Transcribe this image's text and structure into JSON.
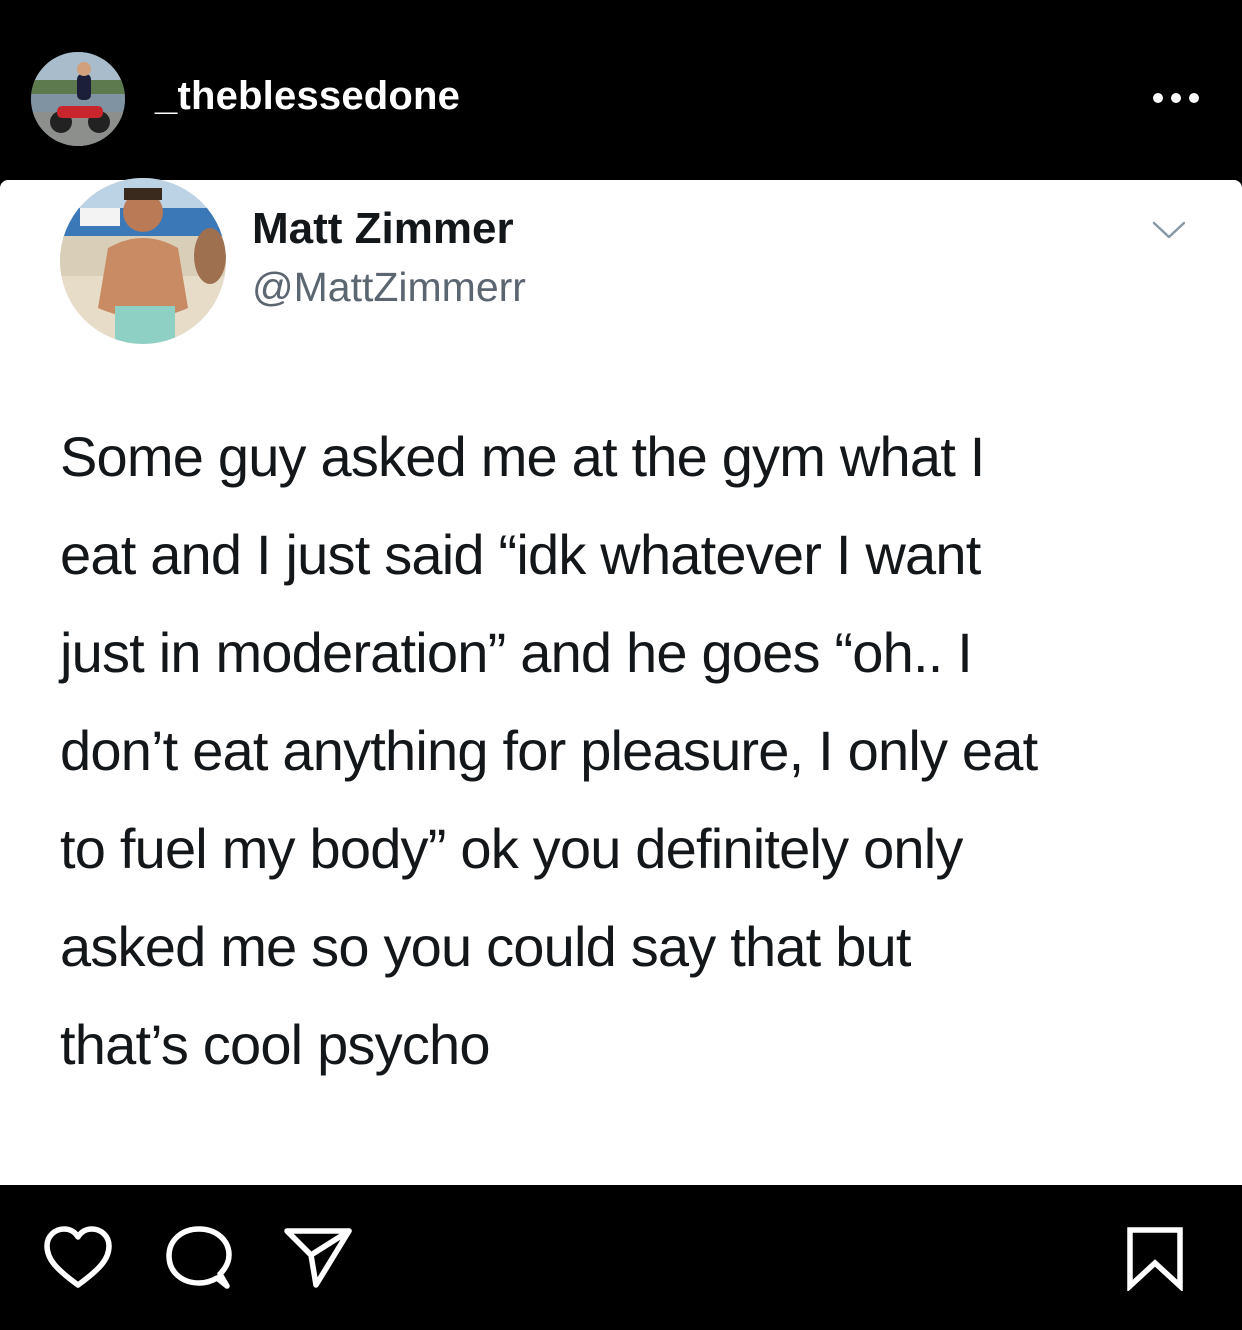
{
  "header": {
    "username": "_theblessedone",
    "avatar_icon": "profile-avatar",
    "more_icon": "more-options-icon"
  },
  "tweet": {
    "display_name": "Matt Zimmer",
    "handle": "@MattZimmerr",
    "menu_icon": "chevron-down-icon",
    "lines": [
      "Some guy asked me at the gym what I",
      "eat and I just said “idk whatever I want",
      "just in moderation” and he goes “oh.. I",
      "don’t eat anything for pleasure, I only eat",
      "to fuel my body” ok you definitely only",
      "asked me so you could say that but",
      "that’s cool psycho"
    ]
  },
  "actions": {
    "icons": [
      "heart-icon",
      "comment-icon",
      "share-icon",
      "bookmark-icon"
    ]
  },
  "colors": {
    "background": "#000000",
    "card": "#ffffff",
    "text_primary": "#14171a",
    "text_secondary": "#5b6670"
  }
}
